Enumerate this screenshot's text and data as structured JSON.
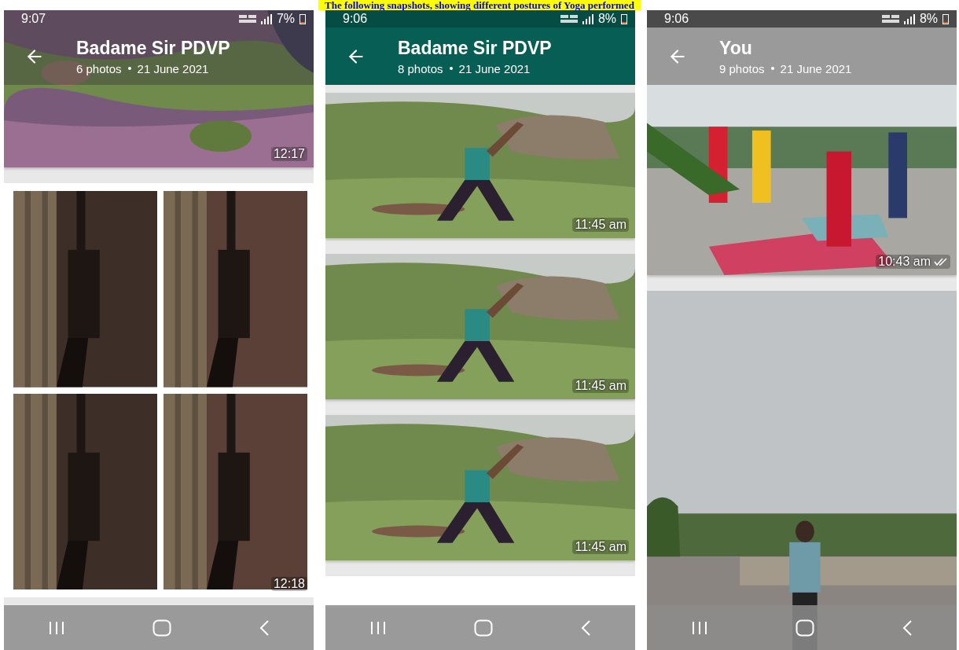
{
  "caption": "The following snapshots, showing different postures of Yoga performed",
  "screens": [
    {
      "status": {
        "time": "9:07",
        "battery": "7%"
      },
      "header": {
        "title": "Badame Sir PDVP",
        "photos": "6 photos",
        "date": "21 June 2021"
      },
      "messages": [
        {
          "time": "12:17",
          "read": false
        },
        {
          "kind": "grid",
          "time": "12:18",
          "read": false
        }
      ]
    },
    {
      "status": {
        "time": "9:06",
        "battery": "8%"
      },
      "header": {
        "title": "Badame Sir PDVP",
        "photos": "8 photos",
        "date": "21 June 2021"
      },
      "messages": [
        {
          "time": "11:45 am",
          "read": false
        },
        {
          "time": "11:45 am",
          "read": false
        },
        {
          "time": "11:45 am",
          "read": false
        },
        {
          "kind": "blank"
        }
      ]
    },
    {
      "status": {
        "time": "9:06",
        "battery": "8%"
      },
      "header": {
        "title": "You",
        "photos": "9 photos",
        "date": "21 June 2021"
      },
      "messages": [
        {
          "time": "10:43 am",
          "read": true
        },
        {
          "kind": "tall"
        }
      ]
    }
  ]
}
